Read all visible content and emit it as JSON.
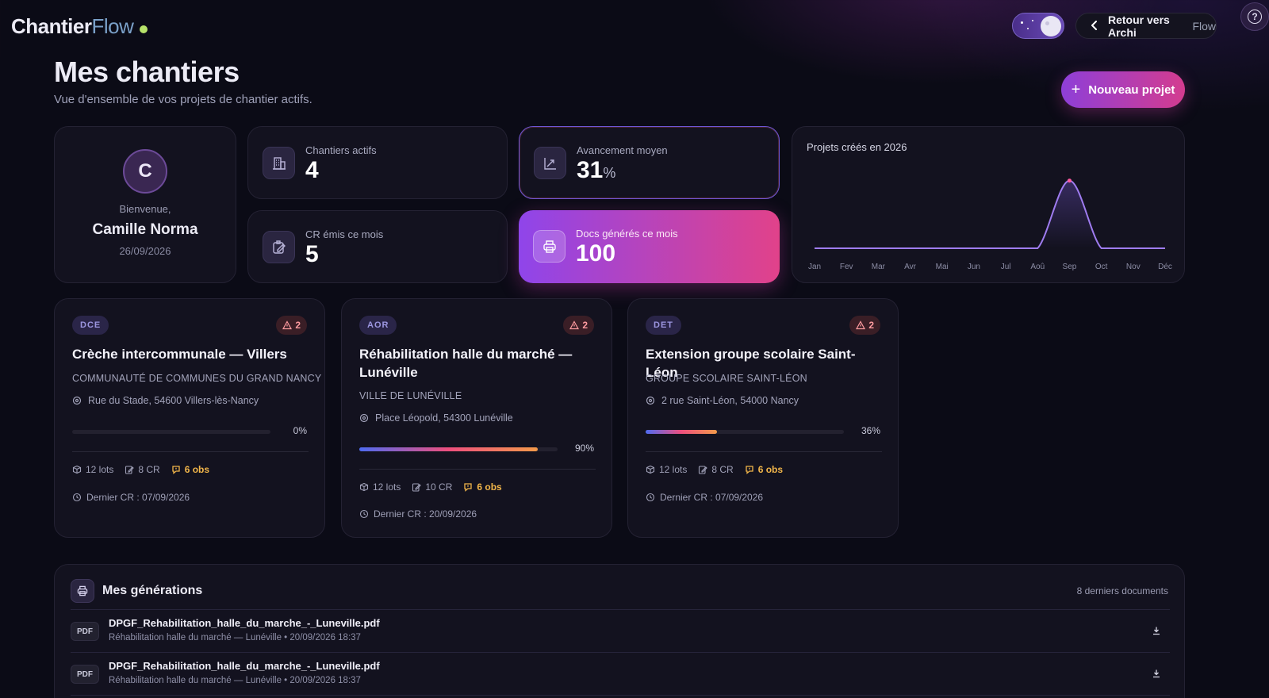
{
  "header": {
    "logo_part1": "Chantier",
    "logo_part2": "Flow",
    "back_label_part1": "Retour vers Archi",
    "back_label_part2": "Flow",
    "help_glyph": "?"
  },
  "page": {
    "title": "Mes chantiers",
    "subtitle": "Vue d'ensemble de vos projets de chantier actifs.",
    "new_project_label": "Nouveau projet"
  },
  "welcome": {
    "initial": "C",
    "greeting": "Bienvenue,",
    "name": "Camille Norma",
    "date": "26/09/2026"
  },
  "stats": {
    "active_label": "Chantiers actifs",
    "active_value": "4",
    "progress_label": "Avancement moyen",
    "progress_value": "31",
    "progress_unit": "%",
    "cr_label": "CR émis ce mois",
    "cr_value": "5",
    "docs_label": "Docs générés ce mois",
    "docs_value": "100"
  },
  "chart_data": {
    "type": "line",
    "title": "Projets créés en 2026",
    "categories": [
      "Jan",
      "Fev",
      "Mar",
      "Avr",
      "Mai",
      "Jun",
      "Jul",
      "Aoû",
      "Sep",
      "Oct",
      "Nov",
      "Déc"
    ],
    "series": [
      {
        "values": [
          0,
          0,
          0,
          0,
          0,
          0,
          0,
          0,
          3,
          0,
          0,
          0
        ]
      }
    ],
    "ylim": [
      0,
      3.2
    ],
    "grid": false,
    "line_color": "#9f7cf0",
    "highlight_color": "#ff5aa0"
  },
  "projects": [
    {
      "phase": "DCE",
      "alerts": "2",
      "title": "Crèche intercommunale — Villers",
      "client": "COMMUNAUTÉ DE COMMUNES DU GRAND NANCY",
      "address": "Rue du Stade, 54600 Villers-lès-Nancy",
      "progress": 0,
      "progress_label": "0%",
      "lots": "12 lots",
      "cr": "8 CR",
      "obs": "6 obs",
      "last_cr": "Dernier CR : 07/09/2026"
    },
    {
      "phase": "AOR",
      "alerts": "2",
      "title": "Réhabilitation halle du marché — Lunéville",
      "client": "VILLE DE LUNÉVILLE",
      "address": "Place Léopold, 54300 Lunéville",
      "progress": 90,
      "progress_label": "90%",
      "lots": "12 lots",
      "cr": "10 CR",
      "obs": "6 obs",
      "last_cr": "Dernier CR : 20/09/2026"
    },
    {
      "phase": "DET",
      "alerts": "2",
      "title": "Extension groupe scolaire Saint-Léon",
      "client": "GROUPE SCOLAIRE SAINT-LÉON",
      "address": "2 rue Saint-Léon, 54000 Nancy",
      "progress": 36,
      "progress_label": "36%",
      "lots": "12 lots",
      "cr": "8 CR",
      "obs": "6 obs",
      "last_cr": "Dernier CR : 07/09/2026"
    }
  ],
  "generations": {
    "title": "Mes générations",
    "count_label": "8 derniers documents",
    "docs": [
      {
        "badge": "PDF",
        "name": "DPGF_Rehabilitation_halle_du_marche_-_Luneville.pdf",
        "subtitle": "Réhabilitation halle du marché — Lunéville • 20/09/2026 18:37"
      },
      {
        "badge": "PDF",
        "name": "DPGF_Rehabilitation_halle_du_marche_-_Luneville.pdf",
        "subtitle": "Réhabilitation halle du marché — Lunéville • 20/09/2026 18:37"
      }
    ]
  },
  "colors": {
    "accent_gradient_start": "#8e3fd8",
    "accent_gradient_end": "#d43c8f",
    "obs_color": "#f2b64a",
    "alert_color": "#ff9ba0",
    "online_dot": "#b7e36a"
  }
}
